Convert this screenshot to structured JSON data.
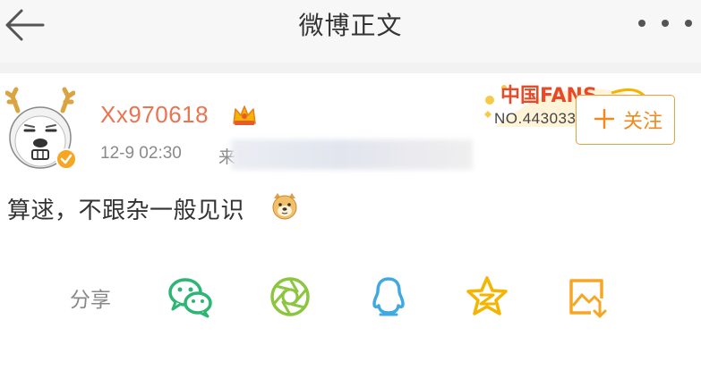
{
  "header": {
    "title": "微博正文",
    "icons": {
      "back": "back-arrow-icon",
      "more": "more-dots-icon"
    }
  },
  "post": {
    "author": {
      "username": "Xx970618",
      "avatar": "deer-bear-avatar",
      "verified": true,
      "member_badge": "crown-icon"
    },
    "time": "12-9 02:30",
    "source_prefix": "来",
    "fans_badge": {
      "logo_text": "中国FANS",
      "number": "NO.443033"
    },
    "follow_button": {
      "label": "关注",
      "icon": "plus-icon"
    },
    "content": {
      "text": "算逑，不跟杂一般见识",
      "emoji": "doge-emoji"
    }
  },
  "share": {
    "label": "分享",
    "targets": [
      {
        "name": "wechat",
        "icon": "wechat-icon",
        "color": "#2bb673"
      },
      {
        "name": "moments",
        "icon": "moments-icon",
        "color": "#8cc63f"
      },
      {
        "name": "qq",
        "icon": "qq-icon",
        "color": "#3fa9e0"
      },
      {
        "name": "qzone",
        "icon": "qzone-icon",
        "color": "#f5b400"
      },
      {
        "name": "save-image",
        "icon": "save-image-icon",
        "color": "#f5a623"
      }
    ]
  },
  "colors": {
    "accent": "#eb7350",
    "follow": "#f08a1e",
    "meta": "#8a8a8a"
  }
}
